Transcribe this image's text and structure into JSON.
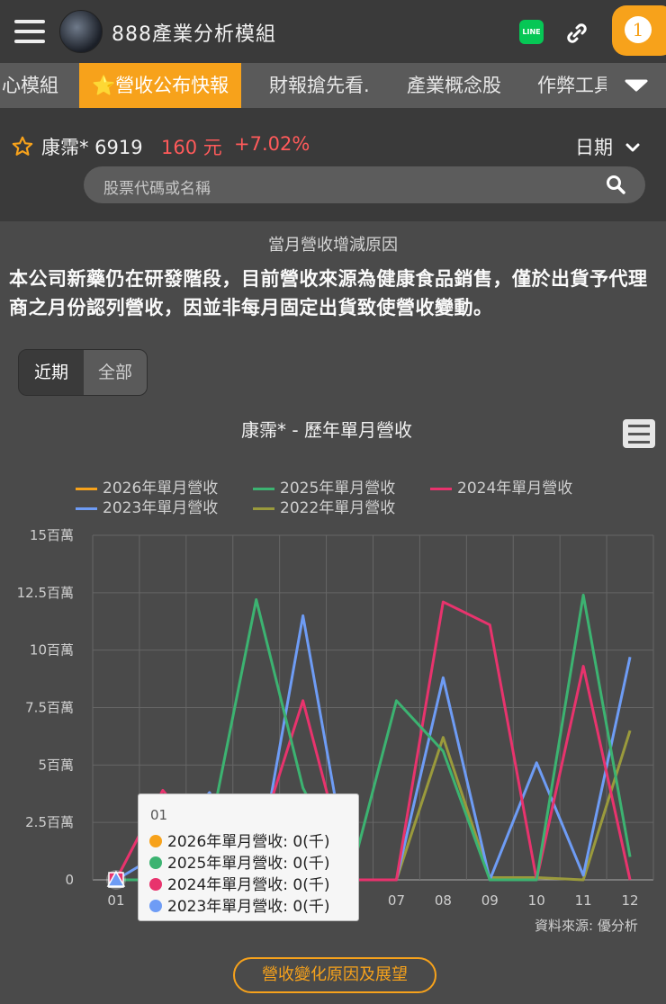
{
  "header": {
    "app_title": "888產業分析模組",
    "notification_count": "1",
    "line_label": "LINE"
  },
  "tabs": [
    {
      "label": "心模組"
    },
    {
      "label": "⭐營收公布快報",
      "active": true
    },
    {
      "label": "財報搶先看."
    },
    {
      "label": "產業概念股"
    },
    {
      "label": "作弊工具"
    }
  ],
  "stock": {
    "name": "康霈* 6919",
    "price": "160 元",
    "change": "+7.02%",
    "date_label": "日期",
    "search_placeholder": "股票代碼或名稱"
  },
  "reason": {
    "section_title": "當月營收增減原因",
    "text": "本公司新藥仍在研發階段，目前營收來源為健康食品銷售，僅於出貨予代理商之月份認列營收，因並非每月固定出貨致使營收變動。"
  },
  "range_toggle": {
    "recent": "近期",
    "all": "全部",
    "selected": "近期"
  },
  "chart_data": {
    "type": "line",
    "title": "康霈* - 歷年單月營收",
    "categories": [
      "01",
      "02",
      "03",
      "04",
      "05",
      "06",
      "07",
      "08",
      "09",
      "10",
      "11",
      "12"
    ],
    "y_ticks": [
      "0",
      "2.5百萬",
      "5百萬",
      "7.5百萬",
      "10百萬",
      "12.5百萬",
      "15百萬"
    ],
    "ylim": [
      0,
      15000
    ],
    "unit": "千",
    "legend_position": "top",
    "grid": true,
    "series": [
      {
        "name": "2026年單月營收",
        "color": "#f7a21b",
        "values": [
          0,
          null,
          null,
          null,
          null,
          null,
          null,
          null,
          null,
          null,
          null,
          null
        ]
      },
      {
        "name": "2025年單月營收",
        "color": "#3cb371",
        "values": [
          0,
          0,
          2000,
          12200,
          4000,
          0,
          7800,
          5600,
          0,
          0,
          12400,
          1000
        ]
      },
      {
        "name": "2024年單月營收",
        "color": "#e8336d",
        "values": [
          0,
          3900,
          1400,
          1400,
          7800,
          0,
          0,
          12100,
          11100,
          0,
          9300,
          0
        ]
      },
      {
        "name": "2023年單月營收",
        "color": "#6e9cf5",
        "values": [
          0,
          1200,
          3800,
          0,
          11500,
          0,
          0,
          8800,
          0,
          5100,
          200,
          9700
        ]
      },
      {
        "name": "2022年單月營收",
        "color": "#9a9a3c",
        "values": [
          0,
          0,
          0,
          0,
          0,
          0,
          0,
          6200,
          100,
          100,
          0,
          6500
        ]
      }
    ]
  },
  "tooltip": {
    "header": "01",
    "rows": [
      {
        "text": "2026年單月營收: 0(千)",
        "color": "#f7a21b"
      },
      {
        "text": "2025年單月營收: 0(千)",
        "color": "#3cb371"
      },
      {
        "text": "2024年單月營收: 0(千)",
        "color": "#e8336d"
      },
      {
        "text": "2023年單月營收: 0(千)",
        "color": "#6e9cf5"
      }
    ]
  },
  "footer": {
    "source": "資料來源: 優分析",
    "button": "營收變化原因及展望"
  }
}
